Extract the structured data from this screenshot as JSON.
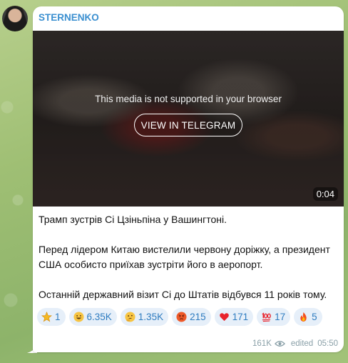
{
  "channel": {
    "name": "STERNENKO"
  },
  "media": {
    "message": "This media is not supported in your browser",
    "button_label": "VIEW IN TELEGRAM",
    "duration": "0:04"
  },
  "post": {
    "paragraphs": [
      "Трамп зустрів Сі Цзіньпіна у Вашингтоні.",
      "Перед лідером Китаю вистелили червону доріжку, а президент США особисто приїхав зустріти його в аеропорт.",
      "Останній державний візит Сі до Штатів відбувся 11 років тому."
    ]
  },
  "reactions": [
    {
      "icon": "star-icon",
      "count": "1"
    },
    {
      "icon": "grinning-face-icon",
      "count": "6.35K"
    },
    {
      "icon": "thinking-face-icon",
      "count": "1.35K"
    },
    {
      "icon": "angry-face-icon",
      "count": "215"
    },
    {
      "icon": "heart-icon",
      "count": "171"
    },
    {
      "icon": "hundred-points-icon",
      "count": "17"
    },
    {
      "icon": "fire-icon",
      "count": "5"
    }
  ],
  "meta": {
    "views": "161K",
    "edited_label": "edited",
    "time": "05:50"
  },
  "colors": {
    "accent": "#3a8fd0",
    "reaction_bg": "#e6eff9",
    "meta": "#8aa0a8"
  }
}
